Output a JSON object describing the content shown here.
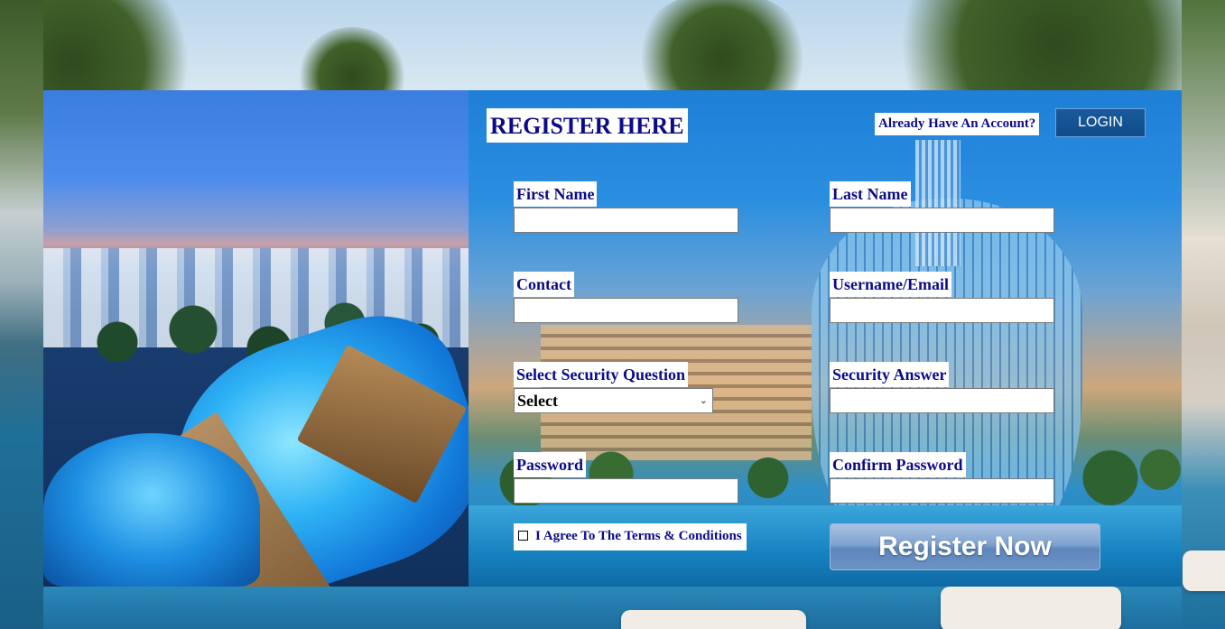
{
  "register": {
    "title": "REGISTER HERE",
    "already_have_account": "Already Have An Account?",
    "login_label": "LOGIN",
    "fields": {
      "first_name": {
        "label": "First Name",
        "value": ""
      },
      "last_name": {
        "label": "Last Name",
        "value": ""
      },
      "contact": {
        "label": "Contact",
        "value": ""
      },
      "username_email": {
        "label": "Username/Email",
        "value": ""
      },
      "security_question": {
        "label": "Select Security Question",
        "selected": "Select"
      },
      "security_answer": {
        "label": "Security Answer",
        "value": ""
      },
      "password": {
        "label": "Password",
        "value": ""
      },
      "confirm_password": {
        "label": "Confirm Password",
        "value": ""
      }
    },
    "terms_label": "I Agree To The Terms & Conditions",
    "terms_checked": false,
    "register_button": "Register Now"
  },
  "colors": {
    "label_text": "#0b0b8a",
    "label_background": "#ffffff",
    "login_button": "#0f4c8a",
    "register_button": "#6d93c5"
  },
  "icons": {
    "dropdown": "chevron-down-icon",
    "checkbox": "checkbox-icon"
  }
}
